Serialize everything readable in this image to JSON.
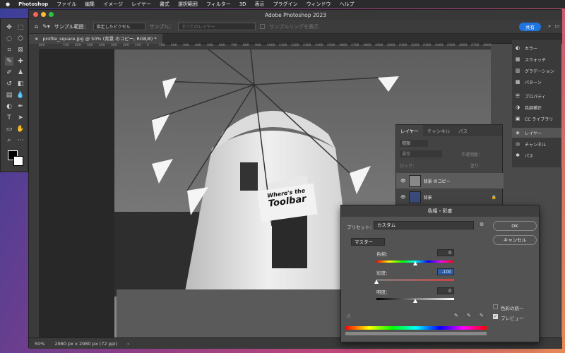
{
  "menubar": {
    "app": "Photoshop",
    "items": [
      "ファイル",
      "編集",
      "イメージ",
      "レイヤー",
      "書式",
      "選択範囲",
      "フィルター",
      "3D",
      "表示",
      "プラグイン",
      "ウィンドウ",
      "ヘルプ"
    ]
  },
  "window": {
    "title": "Adobe Photoshop 2023"
  },
  "options": {
    "sample_label": "サンプル範囲：",
    "sample_value": "指定したピクセル",
    "sample2_label": "サンプル：",
    "sample2_value": "すべてのレイヤー",
    "ring_label": "サンプルリングを表示",
    "share": "共有"
  },
  "document": {
    "tab": "profile_square.jpg @ 50% (背景 のコピー, RGB/8) *"
  },
  "ruler": [
    "800",
    "",
    "700",
    "600",
    "500",
    "400",
    "300",
    "200",
    "100",
    "0",
    "100",
    "200",
    "300",
    "400",
    "500",
    "600",
    "700",
    "800",
    "900",
    "1000",
    "1100",
    "1200",
    "1300",
    "1400",
    "1500",
    "1600",
    "1700",
    "1800",
    "1900",
    "2000",
    "2100",
    "2200",
    "2300",
    "2400",
    "2500",
    "2600",
    "2700",
    "2800"
  ],
  "status": {
    "zoom": "50%",
    "size": "2980 px x 2980 px (72 ppi)"
  },
  "canvas": {
    "sign_line1": "Where's the",
    "sign_line2": "Toolbar"
  },
  "right_panels": [
    "カラー",
    "スウォッチ",
    "グラデーション",
    "パターン",
    "プロパティ",
    "色調補正",
    "CC ライブラリ",
    "レイヤー",
    "チャンネル",
    "パス"
  ],
  "layers": {
    "tabs": [
      "レイヤー",
      "チャンネル",
      "パス"
    ],
    "search": "種類",
    "blend": "通常",
    "opacity_label": "不透明度：",
    "lock": "ロック：",
    "fill_label": "塗り：",
    "items": [
      "背景 のコピー",
      "背景"
    ]
  },
  "dialog": {
    "title": "色相・彩度",
    "preset_label": "プリセット：",
    "preset_value": "カスタム",
    "ok": "OK",
    "cancel": "キャンセル",
    "channel": "マスター",
    "hue_label": "色相：",
    "hue": "0",
    "sat_label": "彩度：",
    "sat": "-100",
    "light_label": "明度：",
    "light": "0",
    "colorize": "色彩の統一",
    "preview": "プレビュー",
    "hue_value": 0,
    "sat_value": -100,
    "light_value": 0
  }
}
